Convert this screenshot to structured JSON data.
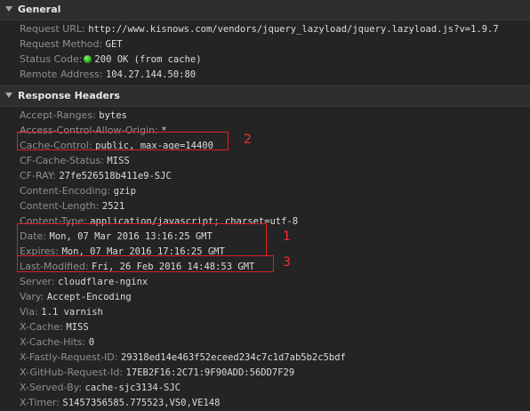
{
  "general": {
    "title": "General",
    "request_url": {
      "key": "Request URL:",
      "value": "http://www.kisnows.com/vendors/jquery_lazyload/jquery.lazyload.js?v=1.9.7"
    },
    "request_method": {
      "key": "Request Method:",
      "value": "GET"
    },
    "status_code": {
      "key": "Status Code:",
      "value": "200 OK (from cache)",
      "status_color": "#2ecc2e"
    },
    "remote_address": {
      "key": "Remote Address:",
      "value": "104.27.144.50:80"
    }
  },
  "response_headers": {
    "title": "Response Headers",
    "items": [
      {
        "key": "Accept-Ranges:",
        "value": "bytes"
      },
      {
        "key": "Access-Control-Allow-Origin:",
        "value": "*"
      },
      {
        "key": "Cache-Control:",
        "value": "public, max-age=14400"
      },
      {
        "key": "CF-Cache-Status:",
        "value": "MISS"
      },
      {
        "key": "CF-RAY:",
        "value": "27fe526518b411e9-SJC"
      },
      {
        "key": "Content-Encoding:",
        "value": "gzip"
      },
      {
        "key": "Content-Length:",
        "value": "2521"
      },
      {
        "key": "Content-Type:",
        "value": "application/javascript; charset=utf-8"
      },
      {
        "key": "Date:",
        "value": "Mon, 07 Mar 2016 13:16:25 GMT"
      },
      {
        "key": "Expires:",
        "value": "Mon, 07 Mar 2016 17:16:25 GMT"
      },
      {
        "key": "Last-Modified:",
        "value": "Fri, 26 Feb 2016 14:48:53 GMT"
      },
      {
        "key": "Server:",
        "value": "cloudflare-nginx"
      },
      {
        "key": "Vary:",
        "value": "Accept-Encoding"
      },
      {
        "key": "Via:",
        "value": "1.1 varnish"
      },
      {
        "key": "X-Cache:",
        "value": "MISS"
      },
      {
        "key": "X-Cache-Hits:",
        "value": "0"
      },
      {
        "key": "X-Fastly-Request-ID:",
        "value": "29318ed14e463f52eceed234c7c1d7ab5b2c5bdf"
      },
      {
        "key": "X-GitHub-Request-Id:",
        "value": "17EB2F16:2C71:9F90ADD:56DD7F29"
      },
      {
        "key": "X-Served-By:",
        "value": "cache-sjc3134-SJC"
      },
      {
        "key": "X-Timer:",
        "value": "S1457356585.775523,VS0,VE148"
      }
    ]
  },
  "annotations": {
    "label_1": "1",
    "label_2": "2",
    "label_3": "3",
    "color": "#ff2a2a"
  }
}
